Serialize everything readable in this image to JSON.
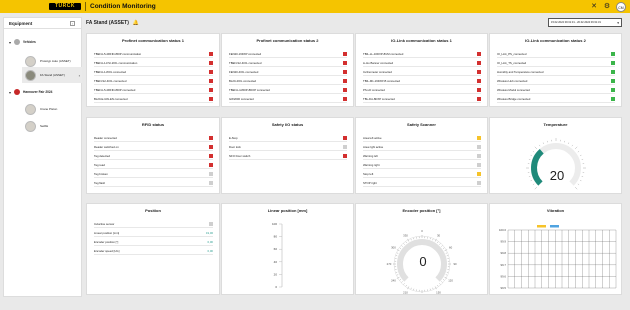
{
  "header": {
    "logo_text": "TURCK",
    "app_title": "Condition Monitoring",
    "avatar_initials": "CM",
    "icons": [
      "tools-icon",
      "gear-icon"
    ]
  },
  "sidebar": {
    "title": "Equipment",
    "groups": [
      {
        "label": "Vehicles",
        "items": [
          {
            "label": "Prototyp Auto (ASSET)",
            "selected": false
          },
          {
            "label": "FA Stand (ASSET)",
            "selected": true
          }
        ]
      },
      {
        "label": "Hannover Fair 2024",
        "items": [
          {
            "label": "Crane Piston",
            "selected": false
          },
          {
            "label": "Seilbk",
            "selected": false
          }
        ]
      }
    ]
  },
  "main": {
    "title": "FA Stand (ASSET)",
    "date_range": "15.02.2024 09:31:31 - 20.02.2024 09:31:31"
  },
  "colors": {
    "red": "#d32f2f",
    "green": "#3bb54a",
    "gray": "#cfcfcf",
    "yellow": "#f6c32a",
    "teal": "#1f8a7a"
  },
  "profinet1": {
    "title": "Profinet communication status 1",
    "rows": [
      {
        "label": "TBEN-L5-4RFID-8DIP communication",
        "status": "red"
      },
      {
        "label": "TBEN-L1-FSI-2IOL communication",
        "status": "red"
      },
      {
        "label": "TBEN-L1-8IOL connected",
        "status": "red"
      },
      {
        "label": "TBEN-S2-4IOL connected",
        "status": "red"
      },
      {
        "label": "TBEN-L5-4RFID-8DIP connected",
        "status": "red"
      },
      {
        "label": "BL20-E-GW-EN connected",
        "status": "red"
      }
    ]
  },
  "profinet2": {
    "title": "Profinet communication status 2",
    "rows": [
      {
        "label": "FEN20-16DXP connected",
        "status": "red"
      },
      {
        "label": "TBEN-S2-4IOL connected",
        "status": "red"
      },
      {
        "label": "FEN20-4IOL connected",
        "status": "red"
      },
      {
        "label": "BL20-4IOL connected",
        "status": "red"
      },
      {
        "label": "TBEN-L4-8DIP-8DOP connected",
        "status": "red"
      },
      {
        "label": "GW2000 connected",
        "status": "red"
      }
    ]
  },
  "iolink1": {
    "title": "IO-Link communication status 1",
    "rows": [
      {
        "label": "TBIL-LL-16DXP-8UM connected",
        "status": "red"
      },
      {
        "label": "Li-Ho Banner connected",
        "status": "red"
      },
      {
        "label": "Inclinometer connected",
        "status": "red"
      },
      {
        "label": "TBIL-M1-16DXP-B connected",
        "status": "red"
      },
      {
        "label": "PS-LD connected",
        "status": "red"
      },
      {
        "label": "TBL-DA-8DXP connected",
        "status": "red"
      }
    ]
  },
  "iolink2": {
    "title": "IO-Link communication status 2",
    "rows": [
      {
        "label": "IO_Link_PS_connected",
        "status": "green"
      },
      {
        "label": "IO_Link_TS_connected",
        "status": "green"
      },
      {
        "label": "Humidity and Temperature connected",
        "status": "green"
      },
      {
        "label": "Wireless Hub connected",
        "status": "green"
      },
      {
        "label": "Wireless Modul connected",
        "status": "green"
      },
      {
        "label": "Wireless Bridge connected",
        "status": "green"
      }
    ]
  },
  "rfid": {
    "title": "RFID status",
    "rows": [
      {
        "label": "Reader connected",
        "status": "red"
      },
      {
        "label": "Reader switched on",
        "status": "red"
      },
      {
        "label": "Tag detected",
        "status": "red"
      },
      {
        "label": "Tag read",
        "status": "red"
      },
      {
        "label": "Tag broken",
        "status": "gray"
      },
      {
        "label": "Tag flash",
        "status": "gray"
      }
    ]
  },
  "safety": {
    "title": "Safety I/O status",
    "rows": [
      {
        "label": "E-Stop",
        "status": "red"
      },
      {
        "label": "Door lock",
        "status": "gray"
      },
      {
        "label": "NFO Door switch",
        "status": "red"
      }
    ]
  },
  "scanner": {
    "title": "Safety Scanner",
    "rows": [
      {
        "label": "Area left active",
        "status": "yellow"
      },
      {
        "label": "Area right active",
        "status": "gray"
      },
      {
        "label": "Warning left",
        "status": "gray"
      },
      {
        "label": "Warning right",
        "status": "gray"
      },
      {
        "label": "Stop left",
        "status": "yellow"
      },
      {
        "label": "STOP right",
        "status": "gray"
      }
    ]
  },
  "temperature": {
    "title": "Temperature",
    "value": "20",
    "fraction": 0.35
  },
  "position": {
    "title": "Position",
    "rows": [
      {
        "label": "Inductive sensor",
        "value": "",
        "status": "gray"
      },
      {
        "label": "Linear position [mm]",
        "value": "19,00"
      },
      {
        "label": "Encoder position [°]",
        "value": "0,00"
      },
      {
        "label": "Encoder speed [U/s]",
        "value": "0,00"
      }
    ]
  },
  "linear": {
    "title": "Linear position [mm]",
    "ticks": [
      "100",
      "80",
      "60",
      "40",
      "20",
      "0"
    ]
  },
  "encoder": {
    "title": "Encoder position [°]",
    "value": "0",
    "ticks": [
      "0",
      "30",
      "60",
      "90",
      "120",
      "150",
      "180",
      "210",
      "240",
      "270",
      "300",
      "330"
    ]
  },
  "chart_data": {
    "type": "bar",
    "title": "Vibration",
    "categories": [],
    "series": [
      {
        "values": []
      },
      {
        "values": []
      }
    ],
    "ylim": [
      99.5,
      100.0
    ],
    "yticks": [
      "100.0",
      "99.9",
      "99.8",
      "99.7",
      "99.6",
      "99.5"
    ],
    "grid": true,
    "legend": "top"
  }
}
